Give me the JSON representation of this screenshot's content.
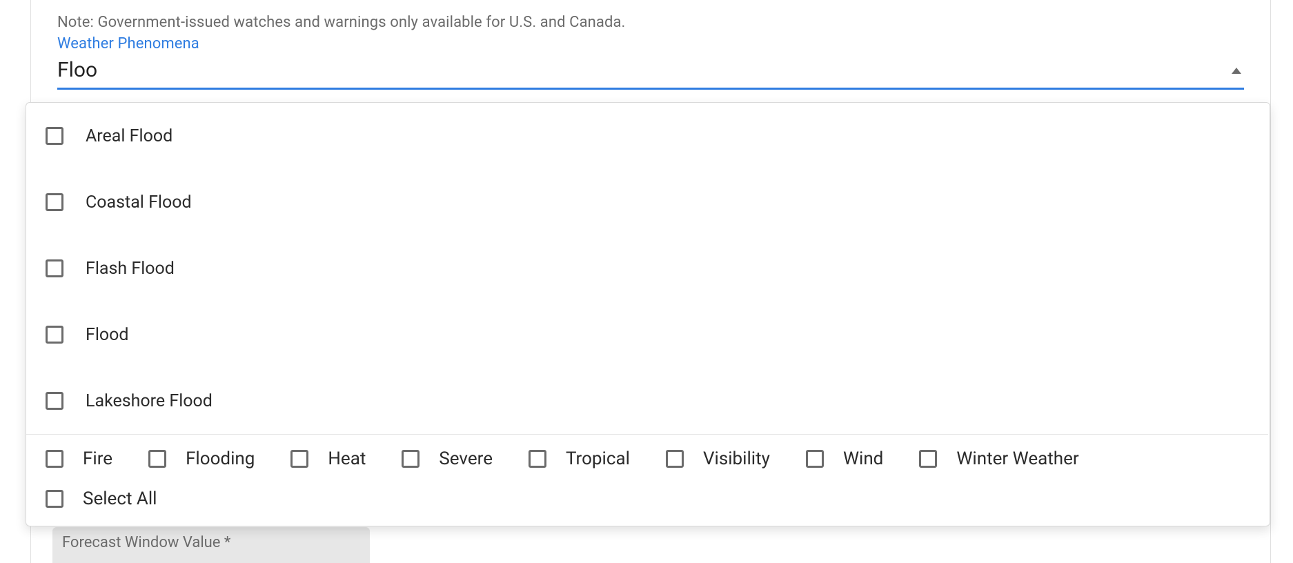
{
  "note": "Note: Government-issued watches and warnings only available for U.S. and Canada.",
  "field_label": "Weather Phenomena",
  "search_value": "Floo",
  "dropdown": {
    "options": [
      {
        "label": "Areal Flood"
      },
      {
        "label": "Coastal Flood"
      },
      {
        "label": "Flash Flood"
      },
      {
        "label": "Flood"
      },
      {
        "label": "Lakeshore Flood"
      }
    ]
  },
  "categories": {
    "items": [
      {
        "label": "Fire"
      },
      {
        "label": "Flooding"
      },
      {
        "label": "Heat"
      },
      {
        "label": "Severe"
      },
      {
        "label": "Tropical"
      },
      {
        "label": "Visibility"
      },
      {
        "label": "Wind"
      },
      {
        "label": "Winter Weather"
      }
    ],
    "select_all_label": "Select All"
  },
  "forecast_window_label": "Forecast Window Value *"
}
